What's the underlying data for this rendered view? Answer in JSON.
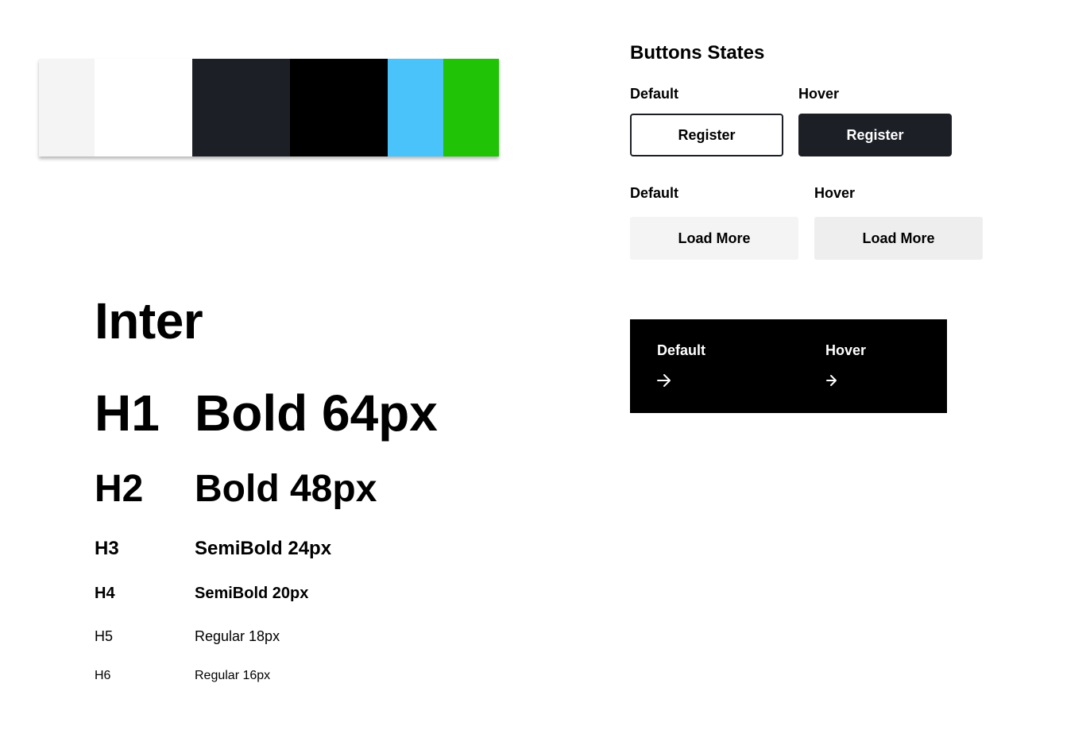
{
  "palette": [
    {
      "name": "light-gray",
      "color": "#F4F4F4"
    },
    {
      "name": "white",
      "color": "#FFFFFF"
    },
    {
      "name": "charcoal",
      "color": "#1C1F26"
    },
    {
      "name": "black",
      "color": "#000000"
    },
    {
      "name": "sky-blue",
      "color": "#4AC3FA"
    },
    {
      "name": "green",
      "color": "#20C305"
    }
  ],
  "typography": {
    "font_name": "Inter",
    "rows": [
      {
        "tag": "H1",
        "spec": "Bold 64px"
      },
      {
        "tag": "H2",
        "spec": "Bold 48px"
      },
      {
        "tag": "H3",
        "spec": "SemiBold 24px"
      },
      {
        "tag": "H4",
        "spec": "SemiBold 20px"
      },
      {
        "tag": "H5",
        "spec": "Regular 18px"
      },
      {
        "tag": "H6",
        "spec": "Regular 16px"
      }
    ]
  },
  "buttons": {
    "title": "Buttons States",
    "register": {
      "default_label": "Default",
      "hover_label": "Hover",
      "text": "Register"
    },
    "load_more": {
      "default_label": "Default",
      "hover_label": "Hover",
      "text": "Load More"
    },
    "arrow": {
      "default_label": "Default",
      "hover_label": "Hover",
      "icon": "arrow-right-icon"
    }
  }
}
